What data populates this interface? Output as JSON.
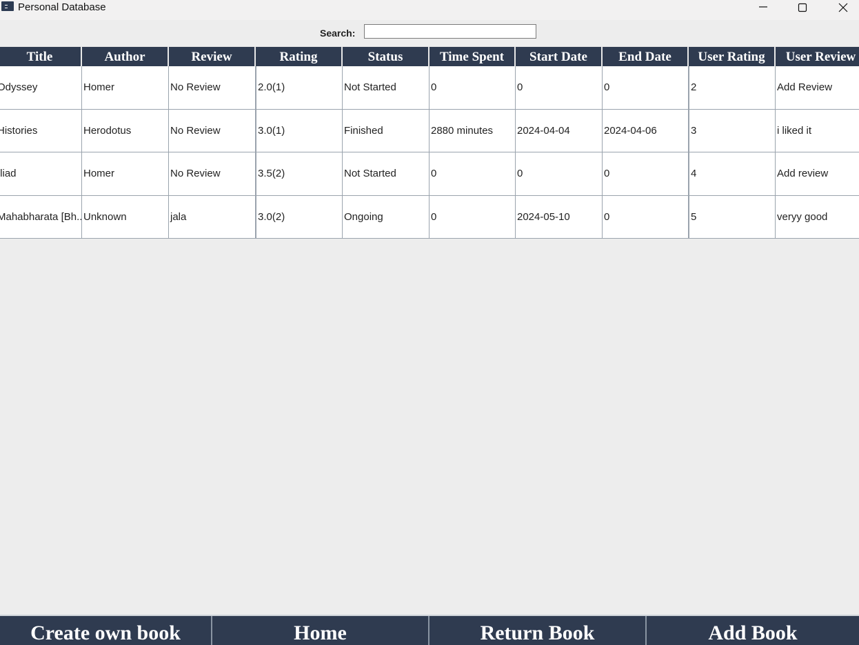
{
  "window": {
    "title": "Personal Database"
  },
  "search": {
    "label": "Search:",
    "value": "",
    "placeholder": ""
  },
  "table": {
    "columns": [
      "Title",
      "Author",
      "Review",
      "Rating",
      "Status",
      "Time Spent",
      "Start Date",
      "End Date",
      "User Rating",
      "User Review"
    ],
    "rows": [
      [
        "Odyssey",
        "Homer",
        "No Review",
        "2.0(1)",
        "Not Started",
        "0",
        "0",
        "0",
        "2",
        "Add Review"
      ],
      [
        "Histories",
        "Herodotus",
        "No Review",
        "3.0(1)",
        "Finished",
        "2880 minutes",
        "2024-04-04",
        "2024-04-06",
        "3",
        "i liked it"
      ],
      [
        "Iliad",
        "Homer",
        "No Review",
        "3.5(2)",
        "Not Started",
        "0",
        "0",
        "0",
        "4",
        "Add review"
      ],
      [
        "Mahabharata [Bh...",
        "Unknown",
        "jala",
        "3.0(2)",
        "Ongoing",
        "0",
        "2024-05-10",
        "0",
        "5",
        "veryy good"
      ]
    ]
  },
  "nav": {
    "buttons": [
      "Create own book",
      "Home",
      "Return Book",
      "Add Book"
    ]
  },
  "colors": {
    "header_bg": "#2f3b50",
    "window_bg": "#ededed"
  },
  "icons": [
    "app-icon",
    "minimize-icon",
    "maximize-icon",
    "close-icon"
  ]
}
